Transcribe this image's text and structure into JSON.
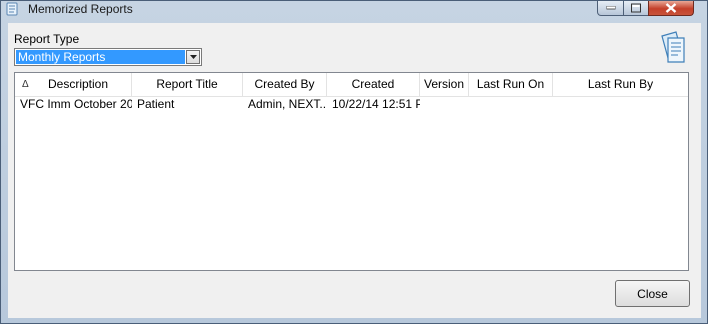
{
  "window": {
    "title": "Memorized Reports"
  },
  "report_type": {
    "label": "Report Type",
    "selected": "Monthly Reports"
  },
  "table": {
    "columns": [
      "Description",
      "Report Title",
      "Created By",
      "Created",
      "Version",
      "Last Run On",
      "Last Run By"
    ],
    "sort_indicator": "Δ",
    "rows": [
      [
        "VFC Imm October 20...",
        "Patient",
        "Admin, NEXT...",
        "10/22/14 12:51 P",
        "",
        "",
        ""
      ]
    ]
  },
  "buttons": {
    "close": "Close"
  }
}
